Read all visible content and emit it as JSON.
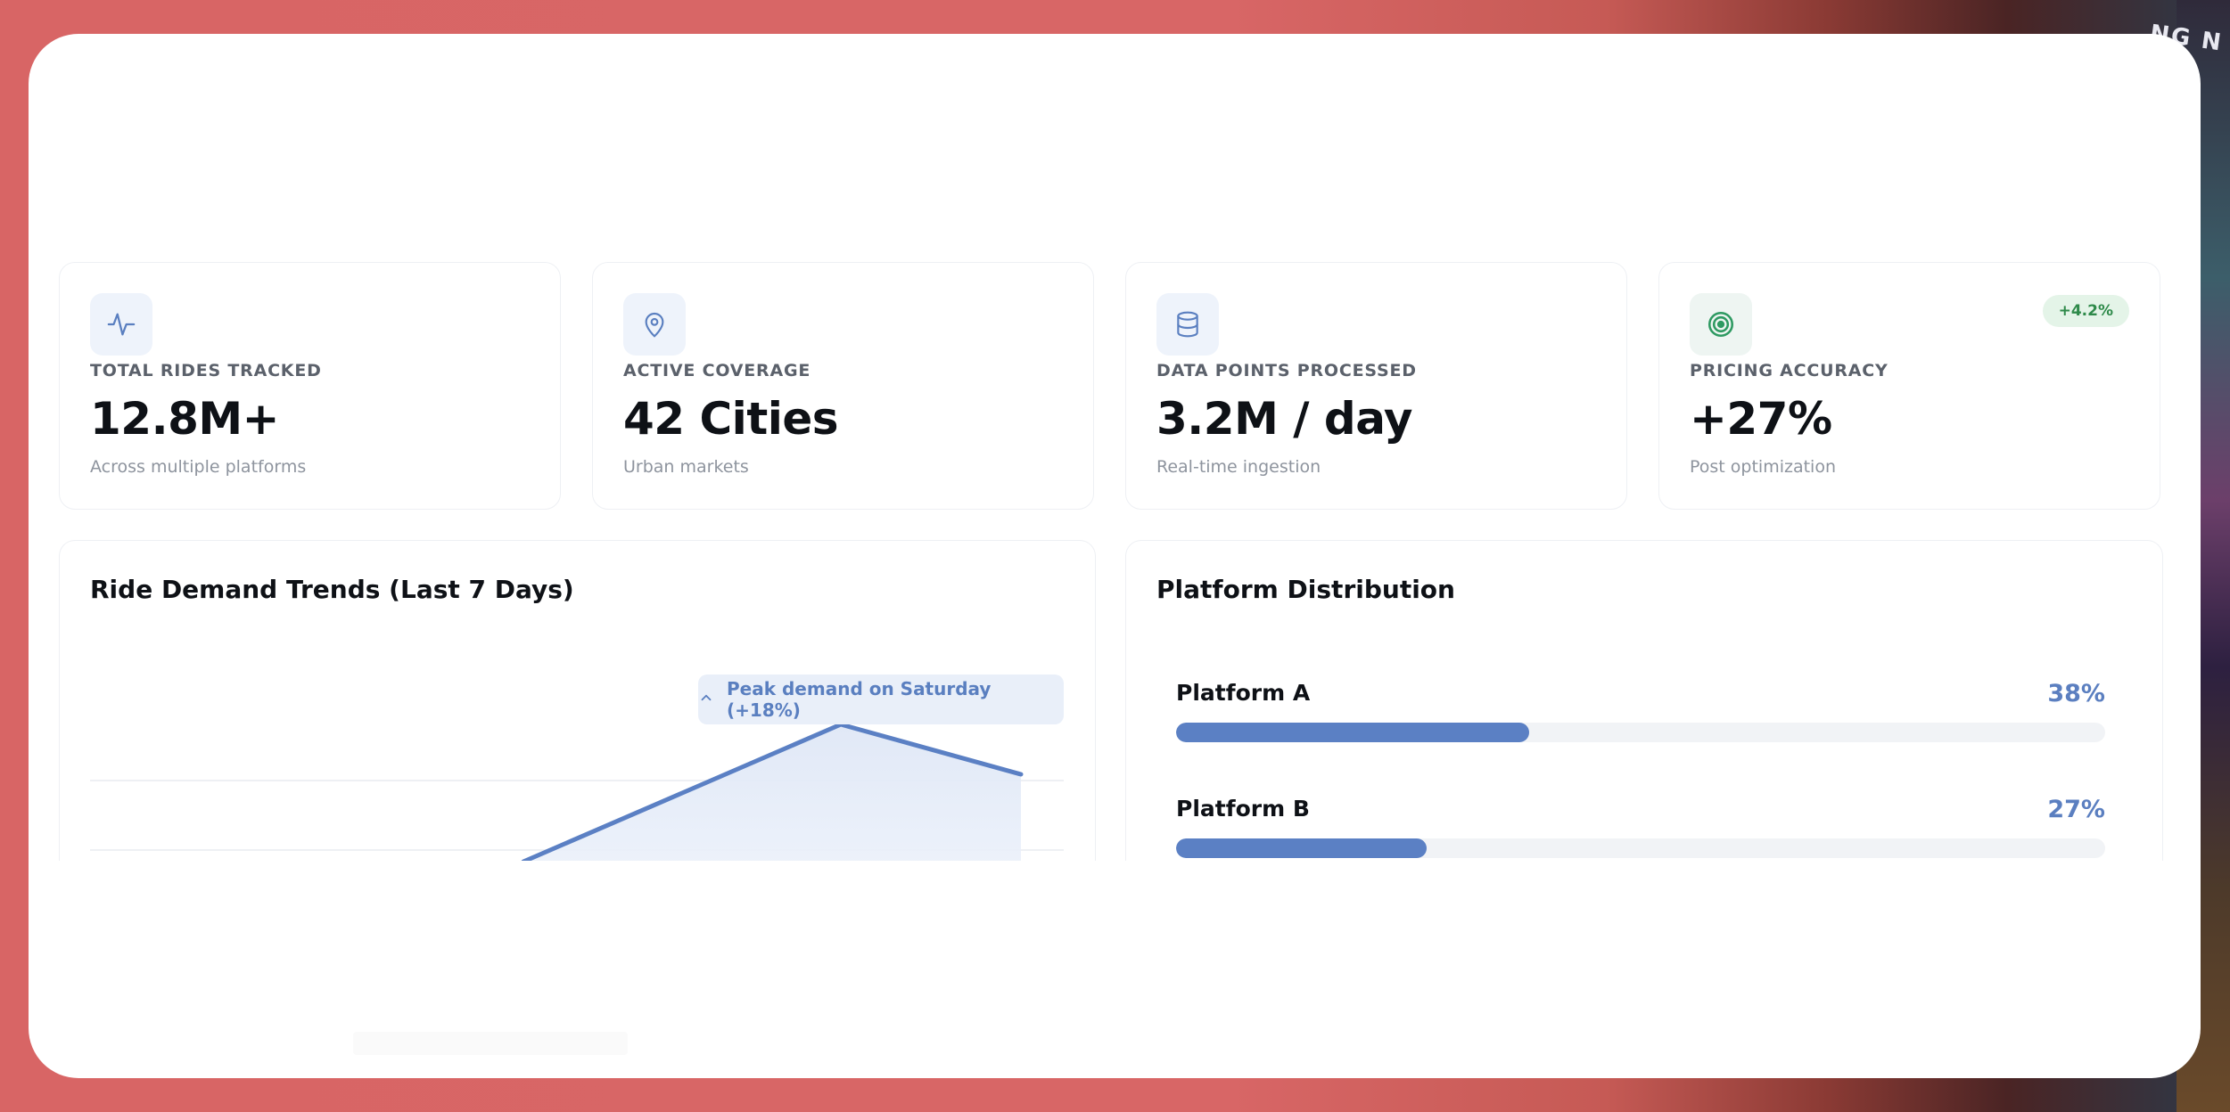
{
  "stats": [
    {
      "label": "TOTAL RIDES TRACKED",
      "value": "12.8M+",
      "sub": "Across multiple platforms",
      "icon": "activity-icon"
    },
    {
      "label": "ACTIVE COVERAGE",
      "value": "42 Cities",
      "sub": "Urban markets",
      "icon": "map-pin-icon"
    },
    {
      "label": "DATA POINTS PROCESSED",
      "value": "3.2M / day",
      "sub": "Real-time ingestion",
      "icon": "database-icon"
    },
    {
      "label": "PRICING ACCURACY",
      "value": "+27%",
      "sub": "Post optimization",
      "icon": "target-icon",
      "badge": "+4.2%"
    }
  ],
  "trends": {
    "title": "Ride Demand Trends (Last 7 Days)",
    "annotation_icon": "chevron-up-icon",
    "annotation": "Peak demand on Saturday (+18%)"
  },
  "distribution": {
    "title": "Platform Distribution",
    "items": [
      {
        "name": "Platform A",
        "pct_label": "38%",
        "pct": 38
      },
      {
        "name": "Platform B",
        "pct_label": "27%",
        "pct": 27
      }
    ]
  },
  "colors": {
    "accent": "#5b80c4",
    "badge_bg": "#e4f4e8",
    "badge_text": "#2e8a4a",
    "background": "#d96464"
  }
}
